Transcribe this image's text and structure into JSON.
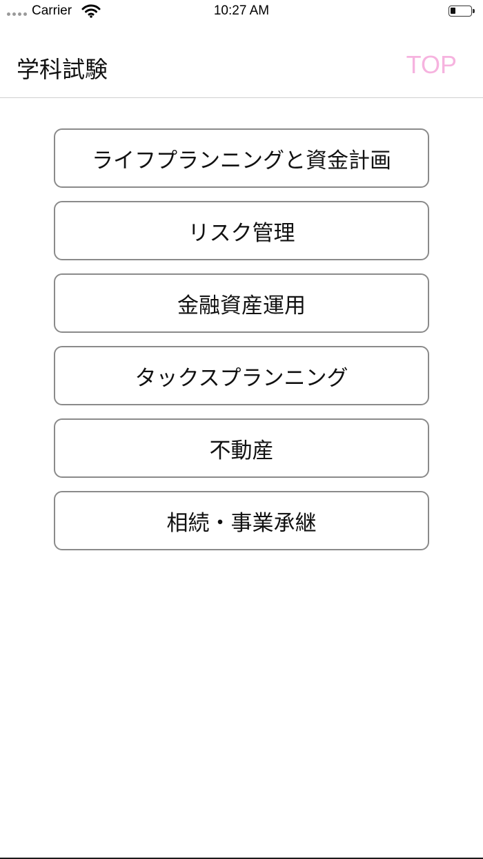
{
  "status_bar": {
    "carrier": "Carrier",
    "time": "10:27 AM"
  },
  "nav": {
    "title": "学科試験",
    "top_label": "TOP",
    "top_color": "#f6b3df"
  },
  "menu": {
    "items": [
      {
        "label": "ライフプランニングと資金計画"
      },
      {
        "label": "リスク管理"
      },
      {
        "label": "金融資産運用"
      },
      {
        "label": "タックスプランニング"
      },
      {
        "label": "不動産"
      },
      {
        "label": "相続・事業承継"
      }
    ]
  }
}
